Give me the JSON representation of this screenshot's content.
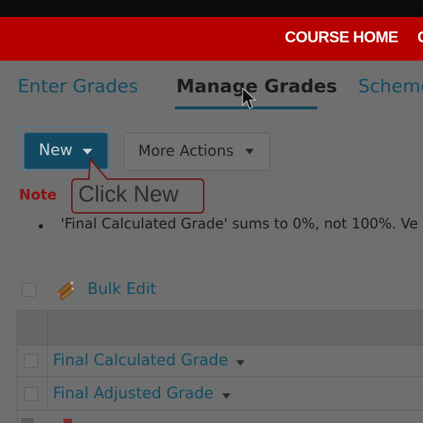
{
  "header": {
    "course_home": "COURSE HOME",
    "extra_letter": "C",
    "brand_color": "#b70000"
  },
  "tabs": [
    {
      "label": "Enter Grades",
      "active": false
    },
    {
      "label": "Manage Grades",
      "active": true
    },
    {
      "label": "Scheme",
      "active": false
    }
  ],
  "toolbar": {
    "new_label": "New",
    "more_actions_label": "More Actions"
  },
  "tooltip": {
    "text": "Click New"
  },
  "note": {
    "label": "Note",
    "text": "'Final Calculated Grade' sums to 0%, not 100%. Ve"
  },
  "bulk_edit": {
    "label": "Bulk Edit",
    "icon": "pencil-icon"
  },
  "grid": {
    "rows": [
      {
        "label": "Final Calculated Grade"
      },
      {
        "label": "Final Adjusted Grade"
      }
    ]
  }
}
